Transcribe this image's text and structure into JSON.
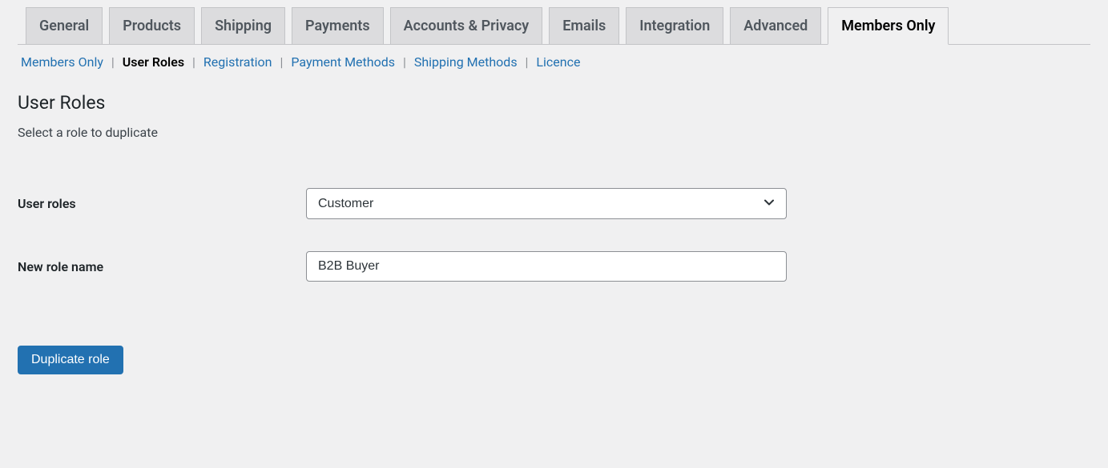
{
  "tabs": [
    {
      "label": "General",
      "active": false
    },
    {
      "label": "Products",
      "active": false
    },
    {
      "label": "Shipping",
      "active": false
    },
    {
      "label": "Payments",
      "active": false
    },
    {
      "label": "Accounts & Privacy",
      "active": false
    },
    {
      "label": "Emails",
      "active": false
    },
    {
      "label": "Integration",
      "active": false
    },
    {
      "label": "Advanced",
      "active": false
    },
    {
      "label": "Members Only",
      "active": true
    }
  ],
  "subtabs": [
    {
      "label": "Members Only",
      "current": false
    },
    {
      "label": "User Roles",
      "current": true
    },
    {
      "label": "Registration",
      "current": false
    },
    {
      "label": "Payment Methods",
      "current": false
    },
    {
      "label": "Shipping Methods",
      "current": false
    },
    {
      "label": "Licence",
      "current": false
    }
  ],
  "section": {
    "title": "User Roles",
    "description": "Select a role to duplicate"
  },
  "form": {
    "user_roles_label": "User roles",
    "user_roles_value": "Customer",
    "new_role_label": "New role name",
    "new_role_value": "B2B Buyer",
    "submit_label": "Duplicate role"
  }
}
